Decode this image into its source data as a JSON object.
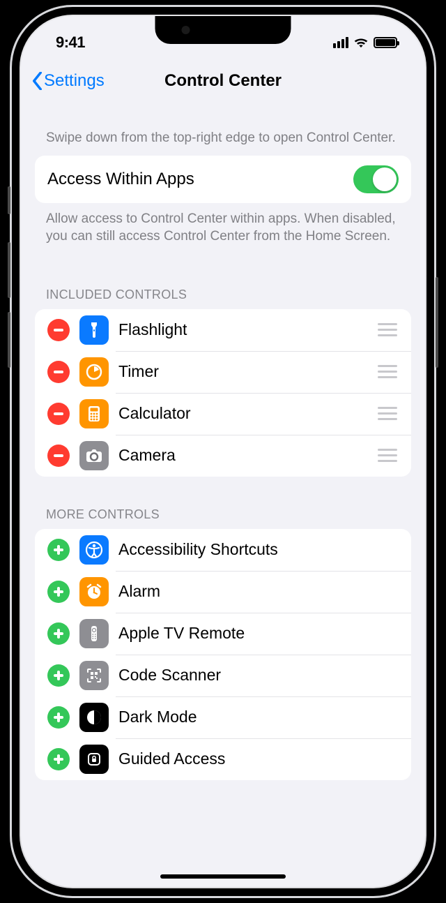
{
  "status": {
    "time": "9:41"
  },
  "nav": {
    "back": "Settings",
    "title": "Control Center"
  },
  "intro_hint": "Swipe down from the top-right edge to open Control Center.",
  "access_row": {
    "label": "Access Within Apps",
    "on": true
  },
  "access_footer": "Allow access to Control Center within apps. When disabled, you can still access Control Center from the Home Screen.",
  "included_header": "INCLUDED CONTROLS",
  "included": [
    {
      "label": "Flashlight",
      "icon": "flashlight",
      "color": "#0a7aff"
    },
    {
      "label": "Timer",
      "icon": "timer",
      "color": "#ff9500"
    },
    {
      "label": "Calculator",
      "icon": "calculator",
      "color": "#ff9500"
    },
    {
      "label": "Camera",
      "icon": "camera",
      "color": "#8e8e93"
    }
  ],
  "more_header": "MORE CONTROLS",
  "more": [
    {
      "label": "Accessibility Shortcuts",
      "icon": "accessibility",
      "color": "#0a7aff"
    },
    {
      "label": "Alarm",
      "icon": "alarm",
      "color": "#ff9500"
    },
    {
      "label": "Apple TV Remote",
      "icon": "remote",
      "color": "#8e8e93"
    },
    {
      "label": "Code Scanner",
      "icon": "qr",
      "color": "#8e8e93"
    },
    {
      "label": "Dark Mode",
      "icon": "darkmode",
      "color": "#000000"
    },
    {
      "label": "Guided Access",
      "icon": "guided",
      "color": "#000000"
    }
  ]
}
